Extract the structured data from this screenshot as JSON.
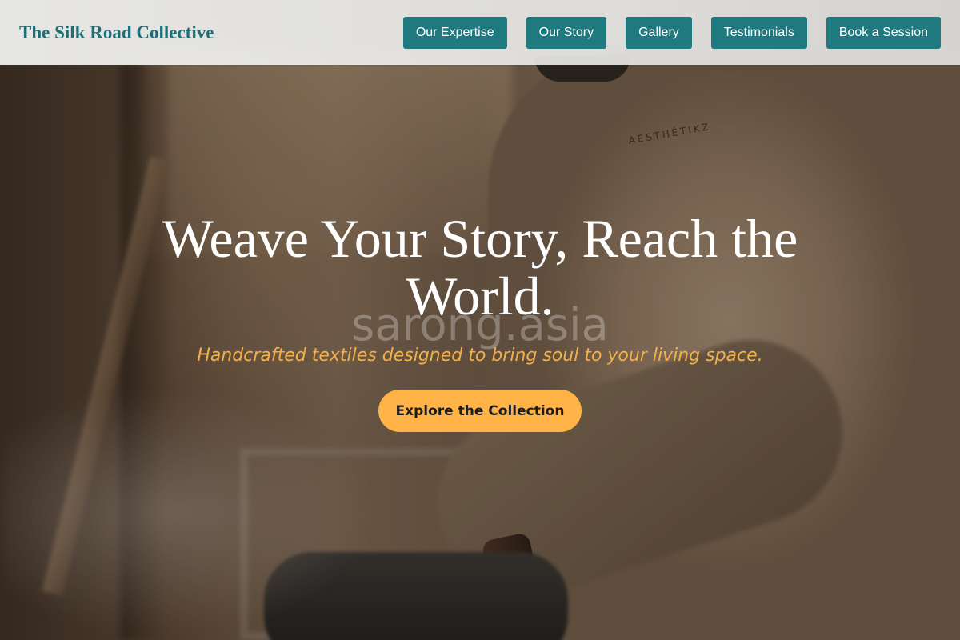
{
  "header": {
    "brand": "The Silk Road Collective",
    "nav": [
      {
        "label": "Our Expertise"
      },
      {
        "label": "Our Story"
      },
      {
        "label": "Gallery"
      },
      {
        "label": "Testimonials"
      },
      {
        "label": "Book a Session"
      }
    ]
  },
  "hero": {
    "headline": "Weave Your Story, Reach the World.",
    "watermark": "sarong.asia",
    "subtitle": "Handcrafted textiles designed to bring soul to your living space.",
    "cta_label": "Explore the Collection",
    "photo_print_text": "AESTHÉTIKZ"
  },
  "colors": {
    "brand": "#1c6f75",
    "nav_button": "#1f7a80",
    "accent": "#ffb347",
    "subtitle": "#f5b04a"
  }
}
